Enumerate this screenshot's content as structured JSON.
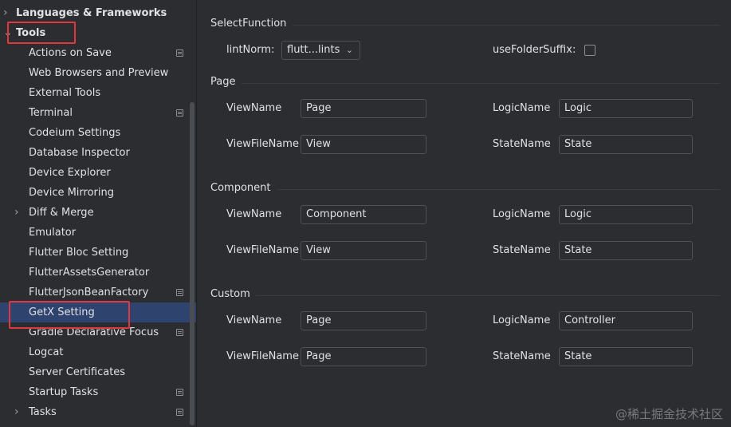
{
  "sidebar": {
    "parent_items": [
      {
        "label": "Languages & Frameworks",
        "chevron": "›"
      },
      {
        "label": "Tools",
        "chevron": "⌄"
      }
    ],
    "items": [
      {
        "label": "Actions on Save",
        "pin": true
      },
      {
        "label": "Web Browsers and Preview"
      },
      {
        "label": "External Tools"
      },
      {
        "label": "Terminal",
        "pin": true
      },
      {
        "label": "Codeium Settings"
      },
      {
        "label": "Database Inspector"
      },
      {
        "label": "Device Explorer"
      },
      {
        "label": "Device Mirroring"
      },
      {
        "label": "Diff & Merge",
        "chevron": "›"
      },
      {
        "label": "Emulator"
      },
      {
        "label": "Flutter Bloc Setting"
      },
      {
        "label": "FlutterAssetsGenerator"
      },
      {
        "label": "FlutterJsonBeanFactory",
        "pin": true
      },
      {
        "label": "GetX Setting",
        "selected": true
      },
      {
        "label": "Gradle Declarative Focus",
        "pin": true
      },
      {
        "label": "Logcat"
      },
      {
        "label": "Server Certificates"
      },
      {
        "label": "Startup Tasks",
        "pin": true
      },
      {
        "label": "Tasks",
        "chevron": "›",
        "pin": true
      }
    ]
  },
  "select_function": {
    "title": "SelectFunction",
    "lint_norm_label": "lintNorm:",
    "lint_norm_value": "flutt...lints",
    "use_folder_suffix_label": "useFolderSuffix:",
    "use_folder_suffix_checked": false
  },
  "page": {
    "title": "Page",
    "view_name_label": "ViewName",
    "view_name": "Page",
    "logic_name_label": "LogicName",
    "logic_name": "Logic",
    "view_file_name_label": "ViewFileName",
    "view_file_name": "View",
    "state_name_label": "StateName",
    "state_name": "State"
  },
  "component": {
    "title": "Component",
    "view_name_label": "ViewName",
    "view_name": "Component",
    "logic_name_label": "LogicName",
    "logic_name": "Logic",
    "view_file_name_label": "ViewFileName",
    "view_file_name": "View",
    "state_name_label": "StateName",
    "state_name": "State"
  },
  "custom": {
    "title": "Custom",
    "view_name_label": "ViewName",
    "view_name": "Page",
    "logic_name_label": "LogicName",
    "logic_name": "Controller",
    "view_file_name_label": "ViewFileName",
    "view_file_name": "Page",
    "state_name_label": "StateName",
    "state_name": "State"
  },
  "watermark": "@稀土掘金技术社区",
  "colors": {
    "background": "#2b2d30",
    "selection": "#2e436e",
    "highlight_box": "#e0383e",
    "text": "#dfe1e5"
  }
}
